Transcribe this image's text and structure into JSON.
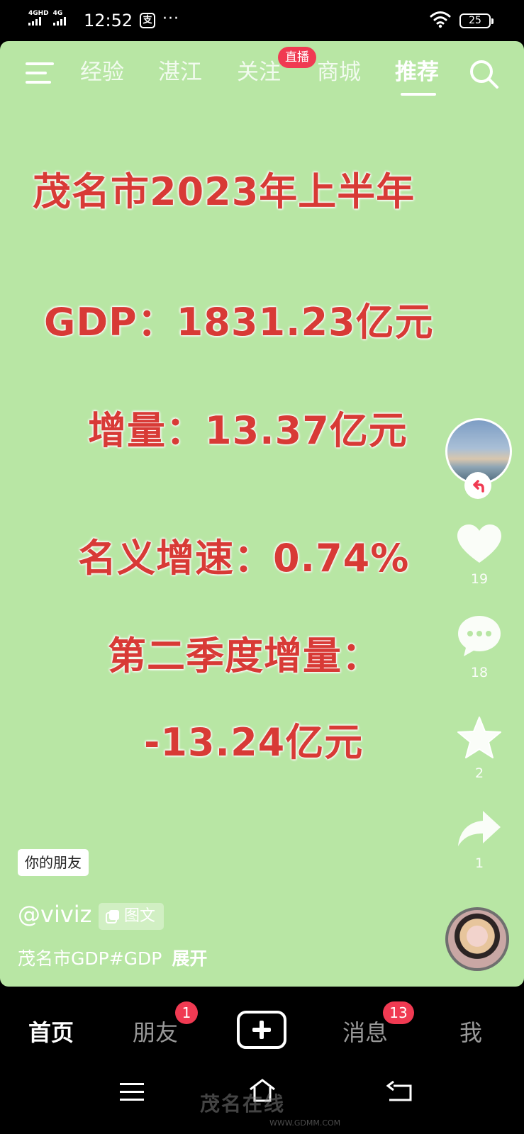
{
  "status_bar": {
    "signal1_label": "4GHD",
    "signal2_label": "4G",
    "time": "12:52",
    "alipay_glyph": "支",
    "more": "···",
    "battery": "25"
  },
  "top_nav": {
    "tabs": [
      "经验",
      "湛江",
      "关注",
      "商城",
      "推荐"
    ],
    "active_tab": "推荐",
    "live_badge": "直播"
  },
  "poster": {
    "line1": "茂名市2023年上半年",
    "line2": "GDP：1831.23亿元",
    "line3": "增量：13.37亿元",
    "line4": "名义增速：0.74%",
    "line5": "第二季度增量：",
    "line6": "-13.24亿元"
  },
  "actions": {
    "likes": "19",
    "comments": "18",
    "favorites": "2",
    "shares": "1"
  },
  "post": {
    "friend_tag": "你的朋友",
    "username": "@viviz",
    "type_label": "图文",
    "caption": "茂名市GDP#GDP",
    "expand": "展开"
  },
  "tab_bar": {
    "home": "首页",
    "friends": "朋友",
    "friends_badge": "1",
    "messages": "消息",
    "messages_badge": "13",
    "me": "我"
  },
  "watermark": {
    "text": "茂名在线",
    "sub": "WWW.GDMM.COM"
  },
  "colors": {
    "background": "#b8e6a4",
    "poster_text": "#d83a36",
    "badge": "#f03a52"
  }
}
